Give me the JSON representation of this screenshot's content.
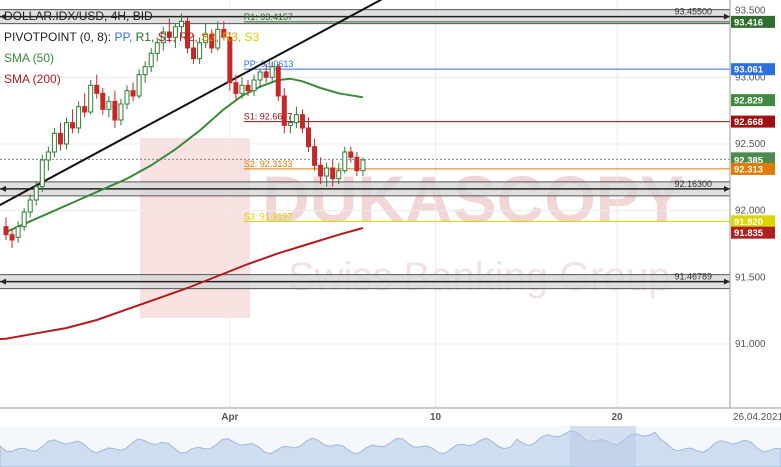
{
  "legend": {
    "symbol": "DOLLAR.IDX/USD, 4H, BID",
    "pivot_prefix": "PIVOTPOINT (0, 8):",
    "pivot_items": [
      {
        "label": "PP,",
        "color": "#2d6ee0"
      },
      {
        "label": "R1,",
        "color": "#2a6e2a"
      },
      {
        "label": "S1,",
        "color": "#b02020"
      },
      {
        "label": "R2,",
        "color": "#b02020"
      },
      {
        "label": "S2,",
        "color": "#e07b00"
      },
      {
        "label": "R3,",
        "color": "#d8b000"
      },
      {
        "label": "S3",
        "color": "#d8d000"
      }
    ],
    "sma50": "SMA (50)",
    "sma200": "SMA (200)"
  },
  "watermark": {
    "brand": "DUKASCOPY",
    "sub": "Swiss Banking Group"
  },
  "colors": {
    "sma50": "#3a8a3a",
    "sma200": "#b01c1c",
    "up": "#2e7d32",
    "down": "#c62828",
    "pp": "#2d6ee0",
    "r1": "#2a6e2a",
    "s1": "#8a1010",
    "s2": "#e07b00",
    "s3": "#d8d000",
    "price": "#4d8a4d"
  },
  "chart_data": {
    "type": "candlestick",
    "ylim": [
      90.55,
      93.55
    ],
    "y_ticks": [
      "93.500",
      "93.000",
      "92.500",
      "92.000",
      "91.500",
      "91.000"
    ],
    "x_ticks": [
      {
        "label": "Apr",
        "bar": 37
      },
      {
        "label": "10",
        "bar": 71
      },
      {
        "label": "20",
        "bar": 101
      }
    ],
    "corner_date": "26.04.2021",
    "candles": [
      [
        91.88,
        91.95,
        91.78,
        91.82
      ],
      [
        91.82,
        91.86,
        91.72,
        91.78
      ],
      [
        91.8,
        91.92,
        91.76,
        91.88
      ],
      [
        91.88,
        92.02,
        91.85,
        91.99
      ],
      [
        91.99,
        92.12,
        91.95,
        92.08
      ],
      [
        92.08,
        92.22,
        92.04,
        92.18
      ],
      [
        92.18,
        92.42,
        92.14,
        92.38
      ],
      [
        92.38,
        92.48,
        92.3,
        92.44
      ],
      [
        92.44,
        92.62,
        92.4,
        92.58
      ],
      [
        92.58,
        92.66,
        92.45,
        92.5
      ],
      [
        92.5,
        92.7,
        92.46,
        92.66
      ],
      [
        92.66,
        92.76,
        92.58,
        92.62
      ],
      [
        92.62,
        92.82,
        92.58,
        92.78
      ],
      [
        92.78,
        92.88,
        92.7,
        92.74
      ],
      [
        92.74,
        92.98,
        92.72,
        92.94
      ],
      [
        92.94,
        93.02,
        92.84,
        92.88
      ],
      [
        92.88,
        92.92,
        92.72,
        92.76
      ],
      [
        92.76,
        92.86,
        92.7,
        92.82
      ],
      [
        92.82,
        92.9,
        92.62,
        92.68
      ],
      [
        92.68,
        92.84,
        92.64,
        92.8
      ],
      [
        92.8,
        92.94,
        92.76,
        92.9
      ],
      [
        92.9,
        92.96,
        92.82,
        92.86
      ],
      [
        92.86,
        93.06,
        92.84,
        93.02
      ],
      [
        93.02,
        93.12,
        92.96,
        93.08
      ],
      [
        93.08,
        93.22,
        93.04,
        93.18
      ],
      [
        93.18,
        93.3,
        93.12,
        93.26
      ],
      [
        93.26,
        93.38,
        93.2,
        93.34
      ],
      [
        93.34,
        93.44,
        93.26,
        93.3
      ],
      [
        93.3,
        93.4,
        93.22,
        93.38
      ],
      [
        93.38,
        93.48,
        93.3,
        93.42
      ],
      [
        93.42,
        93.45,
        93.18,
        93.22
      ],
      [
        93.22,
        93.32,
        93.1,
        93.14
      ],
      [
        93.14,
        93.3,
        93.1,
        93.26
      ],
      [
        93.26,
        93.4,
        93.22,
        93.32
      ],
      [
        93.32,
        93.36,
        93.18,
        93.22
      ],
      [
        93.22,
        93.42,
        93.2,
        93.36
      ],
      [
        93.36,
        93.42,
        93.28,
        93.3
      ],
      [
        93.3,
        93.34,
        92.9,
        92.96
      ],
      [
        92.96,
        93.02,
        92.82,
        92.88
      ],
      [
        92.88,
        93.0,
        92.84,
        92.94
      ],
      [
        92.94,
        92.98,
        92.86,
        92.9
      ],
      [
        92.9,
        93.02,
        92.86,
        92.98
      ],
      [
        92.98,
        93.06,
        92.92,
        93.04
      ],
      [
        93.04,
        93.1,
        92.96,
        93.0
      ],
      [
        93.0,
        93.12,
        92.96,
        93.08
      ],
      [
        93.08,
        93.1,
        92.82,
        92.86
      ],
      [
        92.86,
        92.92,
        92.58,
        92.64
      ],
      [
        92.64,
        92.72,
        92.58,
        92.66
      ],
      [
        92.66,
        92.78,
        92.62,
        92.72
      ],
      [
        92.72,
        92.76,
        92.58,
        92.62
      ],
      [
        92.62,
        92.7,
        92.44,
        92.48
      ],
      [
        92.48,
        92.54,
        92.3,
        92.34
      ],
      [
        92.34,
        92.4,
        92.2,
        92.26
      ],
      [
        92.26,
        92.36,
        92.18,
        92.32
      ],
      [
        92.32,
        92.38,
        92.18,
        92.24
      ],
      [
        92.24,
        92.36,
        92.2,
        92.3
      ],
      [
        92.3,
        92.48,
        92.28,
        92.44
      ],
      [
        92.44,
        92.48,
        92.36,
        92.4
      ],
      [
        92.4,
        92.44,
        92.26,
        92.3
      ],
      [
        92.3,
        92.4,
        92.26,
        92.38
      ]
    ],
    "sma50": [
      [
        0,
        91.84
      ],
      [
        4,
        91.92
      ],
      [
        8,
        92.0
      ],
      [
        12,
        92.08
      ],
      [
        16,
        92.16
      ],
      [
        20,
        92.24
      ],
      [
        24,
        92.34
      ],
      [
        28,
        92.46
      ],
      [
        32,
        92.6
      ],
      [
        36,
        92.76
      ],
      [
        39,
        92.86
      ],
      [
        42,
        92.93
      ],
      [
        45,
        92.98
      ],
      [
        47,
        92.99
      ],
      [
        49,
        92.97
      ],
      [
        52,
        92.92
      ],
      [
        55,
        92.88
      ],
      [
        59,
        92.85
      ]
    ],
    "sma200": [
      [
        -15,
        91.0
      ],
      [
        -8,
        91.02
      ],
      [
        0,
        91.04
      ],
      [
        5,
        91.08
      ],
      [
        10,
        91.12
      ],
      [
        15,
        91.18
      ],
      [
        20,
        91.26
      ],
      [
        25,
        91.34
      ],
      [
        30,
        91.42
      ],
      [
        35,
        91.51
      ],
      [
        40,
        91.6
      ],
      [
        45,
        91.68
      ],
      [
        50,
        91.75
      ],
      [
        55,
        91.82
      ],
      [
        59,
        91.87
      ]
    ],
    "trendline": [
      [
        -15,
        91.7
      ],
      [
        75,
        93.9
      ]
    ],
    "pivots": [
      {
        "name": "R1",
        "label": "R1: 93.4157",
        "value": 93.4157,
        "start_bar": 36
      },
      {
        "name": "PP",
        "label": "PP: 93.0613",
        "value": 93.0613,
        "start_bar": 36
      },
      {
        "name": "S1",
        "label": "S1: 92.6677",
        "value": 92.6677,
        "start_bar": 36
      },
      {
        "name": "S2",
        "label": "S2: 92.3133",
        "value": 92.3133,
        "start_bar": 36
      },
      {
        "name": "S3",
        "label": "S3: 91.9197",
        "value": 91.9197,
        "start_bar": 36
      }
    ],
    "zones": [
      {
        "label": "93.45500",
        "value": 93.455
      },
      {
        "label": "92.16300",
        "value": 92.163
      },
      {
        "label": "91.46789",
        "value": 91.468
      }
    ],
    "price_tags": [
      {
        "text": "93.416",
        "value": 93.416,
        "color": "#2f6e2f"
      },
      {
        "text": "93.061",
        "value": 93.061,
        "color": "#2d6ee0"
      },
      {
        "text": "92.829",
        "value": 92.829,
        "color": "#3f8a3f"
      },
      {
        "text": "92.668",
        "value": 92.668,
        "color": "#a01010"
      },
      {
        "text": "92.385",
        "value": 92.385,
        "color": "#4d8a4d"
      },
      {
        "text": "92.313",
        "value": 92.313,
        "color": "#e07b00"
      },
      {
        "text": "91.920",
        "value": 91.92,
        "color": "#d8d800"
      },
      {
        "text": "91.835",
        "value": 91.835,
        "color": "#b02020"
      }
    ],
    "current_price": 92.385
  }
}
